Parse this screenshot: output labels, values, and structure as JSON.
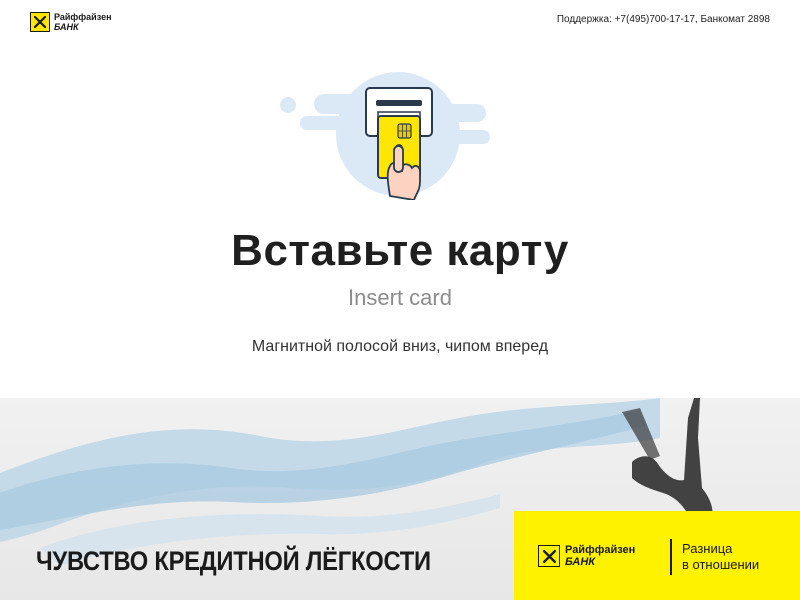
{
  "header": {
    "logo": {
      "name": "Райффайзен",
      "sub": "БАНК",
      "icon": "raiffeisen-logo-icon"
    },
    "support_text": "Поддержка: +7(495)700-17-17, Банкомат 2898"
  },
  "main": {
    "illustration_icon": "insert-card-icon",
    "title": "Вставьте карту",
    "subtitle": "Insert card",
    "hint": "Магнитной полосой вниз, чипом вперед"
  },
  "banner": {
    "slogan": "ЧУВСТВО КРЕДИТНОЙ ЛЁГКОСТИ",
    "logo": {
      "name": "Райффайзен",
      "sub": "БАНК"
    },
    "tagline_line1": "Разница",
    "tagline_line2": "в отношении"
  },
  "colors": {
    "brand_yellow": "#fff200",
    "text_dark": "#1f1f1f",
    "text_muted": "#8c8c8c",
    "illustration_blue": "#dbe9f7"
  }
}
